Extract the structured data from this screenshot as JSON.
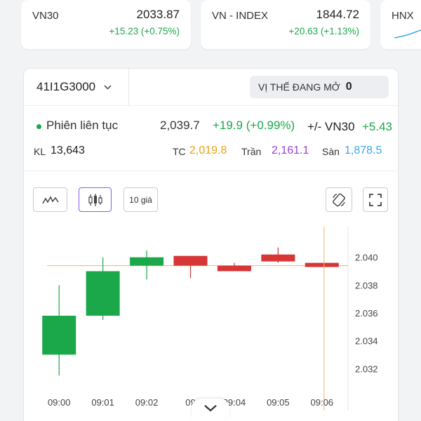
{
  "indices": [
    {
      "name": "VN30",
      "value": "2033.87",
      "change": "+15.23 (+0.75%)"
    },
    {
      "name": "VN - INDEX",
      "value": "1844.72",
      "change": "+20.63 (+1.13%)"
    },
    {
      "name": "HNX"
    }
  ],
  "contract": {
    "code": "41I1G3000"
  },
  "position": {
    "label": "VỊ THẾ ĐANG MỞ",
    "value": "0"
  },
  "session": {
    "label": "Phiên liên tục",
    "price": "2,039.7",
    "change": "+19.9 (+0.99%)",
    "basis_label": "+/- VN30",
    "basis_value": "+5.43"
  },
  "stats": {
    "kl_label": "KL",
    "kl_value": "13,643",
    "tc_label": "TC",
    "tc_value": "2,019.8",
    "tran_label": "Trần",
    "tran_value": "2,161.1",
    "san_label": "Sàn",
    "san_value": "1,878.5"
  },
  "toolbar": {
    "ten_price_label": "10 giá"
  },
  "colors": {
    "up": "#1aa84a",
    "down": "#d63636",
    "ref": "#e8a317",
    "ceiling": "#9b3fd6",
    "floor": "#3aa8e0"
  },
  "chart_data": {
    "type": "candlestick",
    "categories": [
      "09:00",
      "09:01",
      "09:02",
      "09:03",
      "09:04",
      "09:05",
      "09:06"
    ],
    "x_tick_labels": [
      "09:00",
      "09:01",
      "09:02",
      "09",
      "09:04",
      "09:05",
      "09:06"
    ],
    "candles": [
      {
        "open": 2.033,
        "close": 2.0358,
        "high": 2.038,
        "low": 2.0315
      },
      {
        "open": 2.0358,
        "close": 2.039,
        "high": 2.04,
        "low": 2.0355
      },
      {
        "open": 2.0394,
        "close": 2.04,
        "high": 2.0405,
        "low": 2.0384
      },
      {
        "open": 2.0401,
        "close": 2.0394,
        "high": 2.0401,
        "low": 2.0385
      },
      {
        "open": 2.0394,
        "close": 2.039,
        "high": 2.0396,
        "low": 2.039
      },
      {
        "open": 2.0402,
        "close": 2.0397,
        "high": 2.0407,
        "low": 2.0396
      },
      {
        "open": 2.0396,
        "close": 2.0393,
        "high": 2.0396,
        "low": 2.0393
      }
    ],
    "y_ticks": [
      "2.032",
      "2.034",
      "2.036",
      "2.038",
      "2.040"
    ],
    "ylim": [
      2.0305,
      2.0418
    ],
    "reference_line": 2.0394
  }
}
